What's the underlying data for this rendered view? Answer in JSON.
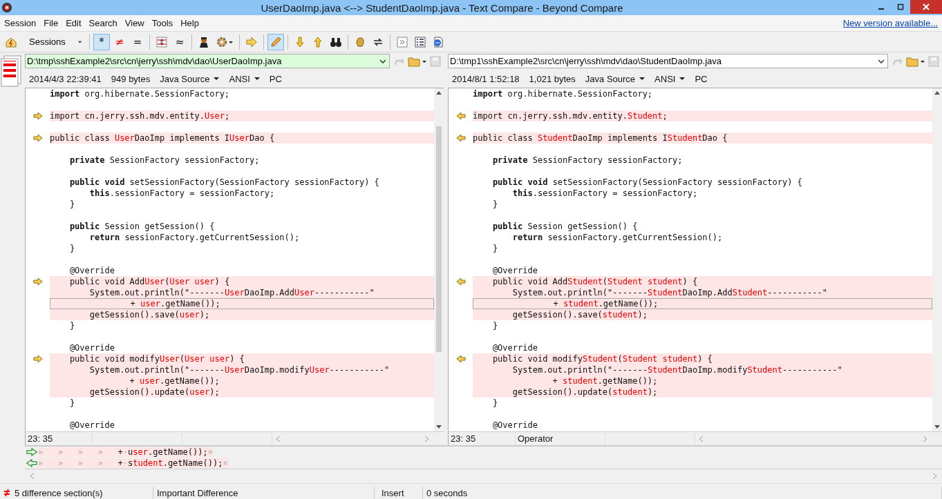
{
  "window": {
    "title": "UserDaoImp.java <--> StudentDaoImp.java - Text Compare - Beyond Compare"
  },
  "menu": [
    "Session",
    "File",
    "Edit",
    "Search",
    "View",
    "Tools",
    "Help"
  ],
  "update_link": "New version available...",
  "toolbar": {
    "sessions_label": "Sessions",
    "filters": [
      {
        "text": "*",
        "selected": true
      },
      {
        "text": "≠",
        "selected": false
      },
      {
        "text": "=",
        "selected": false
      }
    ],
    "similar_glyph": "≈",
    "edit_selected": true
  },
  "panes": [
    {
      "path": "D:\\tmp\\sshExample2\\src\\cn\\jerry\\ssh\\mdv\\dao\\UserDaoImp.java",
      "active": true,
      "date": "2014/4/3 22:39:41",
      "size": "949 bytes",
      "format": "Java Source",
      "encoding": "ANSI",
      "line_ending": "PC",
      "position": "23: 35",
      "lines": [
        {
          "changed": false,
          "marker": false,
          "current": false,
          "segments": [
            {
              "text": "import",
              "kind": "keyword"
            },
            {
              "text": " org.hibernate.SessionFactory;",
              "kind": "plain"
            }
          ]
        },
        {
          "changed": false,
          "marker": false,
          "current": false
        },
        {
          "changed": true,
          "marker": true,
          "current": false,
          "segments": [
            {
              "text": "import cn.jerry.ssh.mdv.entity.",
              "kind": "plain"
            },
            {
              "text": "User",
              "kind": "changed"
            },
            {
              "text": ";",
              "kind": "plain"
            }
          ]
        },
        {
          "changed": false,
          "marker": false,
          "current": false
        },
        {
          "changed": true,
          "marker": true,
          "current": false,
          "segments": [
            {
              "text": "public class ",
              "kind": "plain"
            },
            {
              "text": "User",
              "kind": "changed"
            },
            {
              "text": "DaoImp implements I",
              "kind": "plain"
            },
            {
              "text": "User",
              "kind": "changed"
            },
            {
              "text": "Dao {",
              "kind": "plain"
            }
          ]
        },
        {
          "changed": false,
          "marker": false,
          "current": false
        },
        {
          "changed": false,
          "marker": false,
          "current": false,
          "segments": [
            {
              "text": "    private",
              "kind": "keyword"
            },
            {
              "text": " SessionFactory sessionFactory;",
              "kind": "plain"
            }
          ]
        },
        {
          "changed": false,
          "marker": false,
          "current": false
        },
        {
          "changed": false,
          "marker": false,
          "current": false,
          "segments": [
            {
              "text": "    public void",
              "kind": "keyword"
            },
            {
              "text": " setSessionFactory(SessionFactory sessionFactory) {",
              "kind": "plain"
            }
          ]
        },
        {
          "changed": false,
          "marker": false,
          "current": false,
          "segments": [
            {
              "text": "        this",
              "kind": "keyword"
            },
            {
              "text": ".sessionFactory = sessionFactory;",
              "kind": "plain"
            }
          ]
        },
        {
          "changed": false,
          "marker": false,
          "current": false,
          "segments": [
            {
              "text": "    }",
              "kind": "plain"
            }
          ]
        },
        {
          "changed": false,
          "marker": false,
          "current": false
        },
        {
          "changed": false,
          "marker": false,
          "current": false,
          "segments": [
            {
              "text": "    public",
              "kind": "keyword"
            },
            {
              "text": " Session getSession() {",
              "kind": "plain"
            }
          ]
        },
        {
          "changed": false,
          "marker": false,
          "current": false,
          "segments": [
            {
              "text": "        return",
              "kind": "keyword"
            },
            {
              "text": " sessionFactory.getCurrentSession();",
              "kind": "plain"
            }
          ]
        },
        {
          "changed": false,
          "marker": false,
          "current": false,
          "segments": [
            {
              "text": "    }",
              "kind": "plain"
            }
          ]
        },
        {
          "changed": false,
          "marker": false,
          "current": false
        },
        {
          "changed": false,
          "marker": false,
          "current": false,
          "segments": [
            {
              "text": "    @Override",
              "kind": "plain"
            }
          ]
        },
        {
          "changed": true,
          "marker": true,
          "current": false,
          "segments": [
            {
              "text": "    public void Add",
              "kind": "plain"
            },
            {
              "text": "User",
              "kind": "changed"
            },
            {
              "text": "(",
              "kind": "plain"
            },
            {
              "text": "User user",
              "kind": "changed"
            },
            {
              "text": ") {",
              "kind": "plain"
            }
          ]
        },
        {
          "changed": true,
          "marker": false,
          "current": false,
          "segments": [
            {
              "text": "        System.out.println(\"-------",
              "kind": "plain"
            },
            {
              "text": "User",
              "kind": "changed"
            },
            {
              "text": "DaoImp.Add",
              "kind": "plain"
            },
            {
              "text": "User",
              "kind": "changed"
            },
            {
              "text": "-----------\"",
              "kind": "plain"
            }
          ]
        },
        {
          "changed": true,
          "marker": false,
          "current": true,
          "segments": [
            {
              "text": "                + ",
              "kind": "plain"
            },
            {
              "text": "user",
              "kind": "changed"
            },
            {
              "text": ".getName());",
              "kind": "plain"
            }
          ]
        },
        {
          "changed": true,
          "marker": false,
          "current": false,
          "segments": [
            {
              "text": "        getSession().save(",
              "kind": "plain"
            },
            {
              "text": "user",
              "kind": "changed"
            },
            {
              "text": ");",
              "kind": "plain"
            }
          ]
        },
        {
          "changed": false,
          "marker": false,
          "current": false,
          "segments": [
            {
              "text": "    }",
              "kind": "plain"
            }
          ]
        },
        {
          "changed": false,
          "marker": false,
          "current": false
        },
        {
          "changed": false,
          "marker": false,
          "current": false,
          "segments": [
            {
              "text": "    @Override",
              "kind": "plain"
            }
          ]
        },
        {
          "changed": true,
          "marker": true,
          "current": false,
          "segments": [
            {
              "text": "    public void modify",
              "kind": "plain"
            },
            {
              "text": "User",
              "kind": "changed"
            },
            {
              "text": "(",
              "kind": "plain"
            },
            {
              "text": "User user",
              "kind": "changed"
            },
            {
              "text": ") {",
              "kind": "plain"
            }
          ]
        },
        {
          "changed": true,
          "marker": false,
          "current": false,
          "segments": [
            {
              "text": "        System.out.println(\"-------",
              "kind": "plain"
            },
            {
              "text": "User",
              "kind": "changed"
            },
            {
              "text": "DaoImp.modify",
              "kind": "plain"
            },
            {
              "text": "User",
              "kind": "changed"
            },
            {
              "text": "-----------\"",
              "kind": "plain"
            }
          ]
        },
        {
          "changed": true,
          "marker": false,
          "current": false,
          "segments": [
            {
              "text": "                + ",
              "kind": "plain"
            },
            {
              "text": "user",
              "kind": "changed"
            },
            {
              "text": ".getName());",
              "kind": "plain"
            }
          ]
        },
        {
          "changed": true,
          "marker": false,
          "current": false,
          "segments": [
            {
              "text": "        getSession().update(",
              "kind": "plain"
            },
            {
              "text": "user",
              "kind": "changed"
            },
            {
              "text": ");",
              "kind": "plain"
            }
          ]
        },
        {
          "changed": false,
          "marker": false,
          "current": false,
          "segments": [
            {
              "text": "    }",
              "kind": "plain"
            }
          ]
        },
        {
          "changed": false,
          "marker": false,
          "current": false
        },
        {
          "changed": false,
          "marker": false,
          "current": false,
          "segments": [
            {
              "text": "    @Override",
              "kind": "plain"
            }
          ]
        }
      ]
    },
    {
      "path": "D:\\tmp1\\sshExample2\\src\\cn\\jerry\\ssh\\mdv\\dao\\StudentDaoImp.java",
      "active": false,
      "date": "2014/8/1 1:52:18",
      "size": "1,021 bytes",
      "format": "Java Source",
      "encoding": "ANSI",
      "line_ending": "PC",
      "position": "23: 35",
      "token_type": "Operator",
      "lines": [
        {
          "changed": false,
          "marker": false,
          "current": false,
          "segments": [
            {
              "text": "import",
              "kind": "keyword"
            },
            {
              "text": " org.hibernate.SessionFactory;",
              "kind": "plain"
            }
          ]
        },
        {
          "changed": false,
          "marker": false,
          "current": false
        },
        {
          "changed": true,
          "marker": true,
          "current": false,
          "segments": [
            {
              "text": "import cn.jerry.ssh.mdv.entity.",
              "kind": "plain"
            },
            {
              "text": "Student",
              "kind": "changed"
            },
            {
              "text": ";",
              "kind": "plain"
            }
          ]
        },
        {
          "changed": false,
          "marker": false,
          "current": false
        },
        {
          "changed": true,
          "marker": true,
          "current": false,
          "segments": [
            {
              "text": "public class ",
              "kind": "plain"
            },
            {
              "text": "Student",
              "kind": "changed"
            },
            {
              "text": "DaoImp implements I",
              "kind": "plain"
            },
            {
              "text": "Student",
              "kind": "changed"
            },
            {
              "text": "Dao {",
              "kind": "plain"
            }
          ]
        },
        {
          "changed": false,
          "marker": false,
          "current": false
        },
        {
          "changed": false,
          "marker": false,
          "current": false,
          "segments": [
            {
              "text": "    private",
              "kind": "keyword"
            },
            {
              "text": " SessionFactory sessionFactory;",
              "kind": "plain"
            }
          ]
        },
        {
          "changed": false,
          "marker": false,
          "current": false
        },
        {
          "changed": false,
          "marker": false,
          "current": false,
          "segments": [
            {
              "text": "    public void",
              "kind": "keyword"
            },
            {
              "text": " setSessionFactory(SessionFactory sessionFactory) {",
              "kind": "plain"
            }
          ]
        },
        {
          "changed": false,
          "marker": false,
          "current": false,
          "segments": [
            {
              "text": "        this",
              "kind": "keyword"
            },
            {
              "text": ".sessionFactory = sessionFactory;",
              "kind": "plain"
            }
          ]
        },
        {
          "changed": false,
          "marker": false,
          "current": false,
          "segments": [
            {
              "text": "    }",
              "kind": "plain"
            }
          ]
        },
        {
          "changed": false,
          "marker": false,
          "current": false
        },
        {
          "changed": false,
          "marker": false,
          "current": false,
          "segments": [
            {
              "text": "    public",
              "kind": "keyword"
            },
            {
              "text": " Session getSession() {",
              "kind": "plain"
            }
          ]
        },
        {
          "changed": false,
          "marker": false,
          "current": false,
          "segments": [
            {
              "text": "        return",
              "kind": "keyword"
            },
            {
              "text": " sessionFactory.getCurrentSession();",
              "kind": "plain"
            }
          ]
        },
        {
          "changed": false,
          "marker": false,
          "current": false,
          "segments": [
            {
              "text": "    }",
              "kind": "plain"
            }
          ]
        },
        {
          "changed": false,
          "marker": false,
          "current": false
        },
        {
          "changed": false,
          "marker": false,
          "current": false,
          "segments": [
            {
              "text": "    @Override",
              "kind": "plain"
            }
          ]
        },
        {
          "changed": true,
          "marker": true,
          "current": false,
          "segments": [
            {
              "text": "    public void Add",
              "kind": "plain"
            },
            {
              "text": "Student",
              "kind": "changed"
            },
            {
              "text": "(",
              "kind": "plain"
            },
            {
              "text": "Student student",
              "kind": "changed"
            },
            {
              "text": ") {",
              "kind": "plain"
            }
          ]
        },
        {
          "changed": true,
          "marker": false,
          "current": false,
          "segments": [
            {
              "text": "        System.out.println(\"-------",
              "kind": "plain"
            },
            {
              "text": "Student",
              "kind": "changed"
            },
            {
              "text": "DaoImp.Add",
              "kind": "plain"
            },
            {
              "text": "Student",
              "kind": "changed"
            },
            {
              "text": "-----------\"",
              "kind": "plain"
            }
          ]
        },
        {
          "changed": true,
          "marker": false,
          "current": true,
          "segments": [
            {
              "text": "                + ",
              "kind": "plain"
            },
            {
              "text": "student",
              "kind": "changed"
            },
            {
              "text": ".getName());",
              "kind": "plain"
            }
          ]
        },
        {
          "changed": true,
          "marker": false,
          "current": false,
          "segments": [
            {
              "text": "        getSession().save(",
              "kind": "plain"
            },
            {
              "text": "student",
              "kind": "changed"
            },
            {
              "text": ");",
              "kind": "plain"
            }
          ]
        },
        {
          "changed": false,
          "marker": false,
          "current": false,
          "segments": [
            {
              "text": "    }",
              "kind": "plain"
            }
          ]
        },
        {
          "changed": false,
          "marker": false,
          "current": false
        },
        {
          "changed": false,
          "marker": false,
          "current": false,
          "segments": [
            {
              "text": "    @Override",
              "kind": "plain"
            }
          ]
        },
        {
          "changed": true,
          "marker": true,
          "current": false,
          "segments": [
            {
              "text": "    public void modify",
              "kind": "plain"
            },
            {
              "text": "Student",
              "kind": "changed"
            },
            {
              "text": "(",
              "kind": "plain"
            },
            {
              "text": "Student student",
              "kind": "changed"
            },
            {
              "text": ") {",
              "kind": "plain"
            }
          ]
        },
        {
          "changed": true,
          "marker": false,
          "current": false,
          "segments": [
            {
              "text": "        System.out.println(\"-------",
              "kind": "plain"
            },
            {
              "text": "Student",
              "kind": "changed"
            },
            {
              "text": "DaoImp.modify",
              "kind": "plain"
            },
            {
              "text": "Student",
              "kind": "changed"
            },
            {
              "text": "-----------\"",
              "kind": "plain"
            }
          ]
        },
        {
          "changed": true,
          "marker": false,
          "current": false,
          "segments": [
            {
              "text": "                + ",
              "kind": "plain"
            },
            {
              "text": "student",
              "kind": "changed"
            },
            {
              "text": ".getName());",
              "kind": "plain"
            }
          ]
        },
        {
          "changed": true,
          "marker": false,
          "current": false,
          "segments": [
            {
              "text": "        getSession().update(",
              "kind": "plain"
            },
            {
              "text": "student",
              "kind": "changed"
            },
            {
              "text": ");",
              "kind": "plain"
            }
          ]
        },
        {
          "changed": false,
          "marker": false,
          "current": false,
          "segments": [
            {
              "text": "    }",
              "kind": "plain"
            }
          ]
        },
        {
          "changed": false,
          "marker": false,
          "current": false
        },
        {
          "changed": false,
          "marker": false,
          "current": false,
          "segments": [
            {
              "text": "    @Override",
              "kind": "plain"
            }
          ]
        }
      ]
    }
  ],
  "detail_lines": [
    {
      "segments": [
        {
          "text": "»   »   »   »   ",
          "kind": "whitespace"
        },
        {
          "text": "+",
          "kind": "plain"
        },
        {
          "text": "·",
          "kind": "whitespace"
        },
        {
          "text": "u",
          "kind": "plain"
        },
        {
          "text": "ser",
          "kind": "changed"
        },
        {
          "text": ".getName());",
          "kind": "plain"
        },
        {
          "text": "¤",
          "kind": "whitespace"
        }
      ]
    },
    {
      "segments": [
        {
          "text": "»   »   »   »   ",
          "kind": "whitespace"
        },
        {
          "text": "+",
          "kind": "plain"
        },
        {
          "text": "·",
          "kind": "whitespace"
        },
        {
          "text": "s",
          "kind": "plain"
        },
        {
          "text": "tudent",
          "kind": "changed"
        },
        {
          "text": ".getName());",
          "kind": "plain"
        },
        {
          "text": "¤",
          "kind": "whitespace"
        }
      ]
    }
  ],
  "status_bar": {
    "sections": "5 difference section(s)",
    "difference": "Important Difference",
    "mode": "Insert",
    "time": "0 seconds"
  }
}
